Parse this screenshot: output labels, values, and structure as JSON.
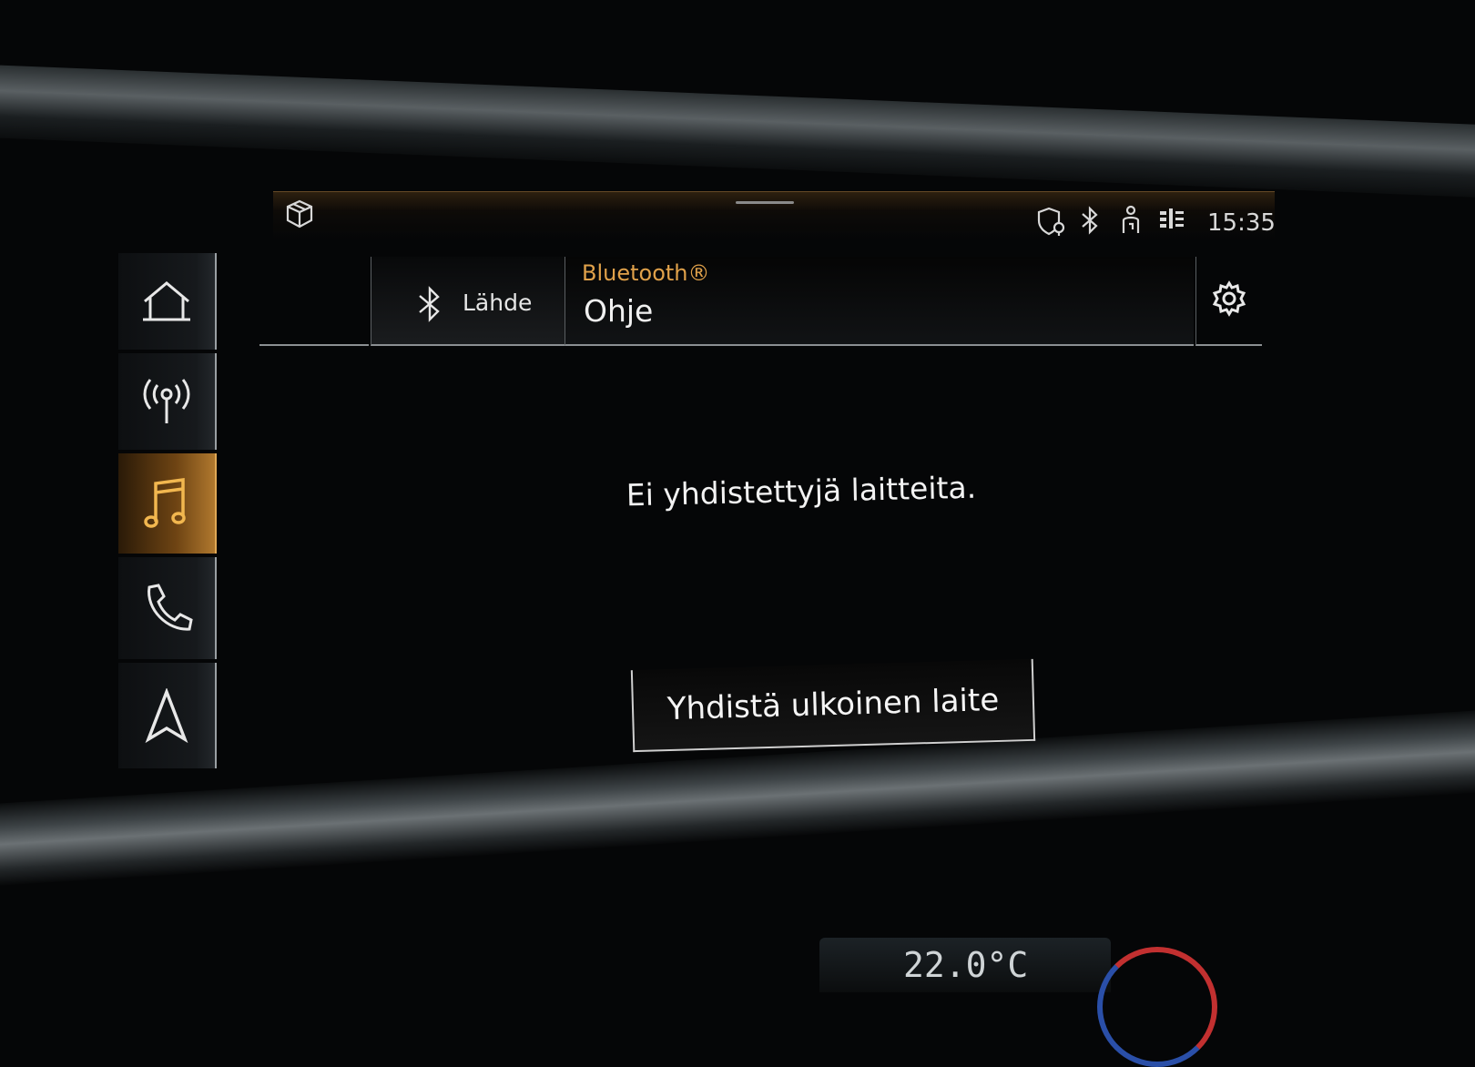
{
  "status_bar": {
    "time": "15:35",
    "icons": [
      "cube-icon",
      "location-shield-icon",
      "bluetooth-icon",
      "person-wifi-icon",
      "data-icon"
    ]
  },
  "sidebar": {
    "items": [
      {
        "icon": "home-icon",
        "active": false
      },
      {
        "icon": "radio-icon",
        "active": false
      },
      {
        "icon": "music-icon",
        "active": true
      },
      {
        "icon": "phone-icon",
        "active": false
      },
      {
        "icon": "navigation-icon",
        "active": false
      }
    ]
  },
  "tabs": {
    "source_label": "Lähde",
    "supertitle": "Bluetooth®",
    "title": "Ohje"
  },
  "content": {
    "empty_message": "Ei yhdistettyjä laitteita.",
    "connect_button_label": "Yhdistä ulkoinen laite"
  },
  "climate": {
    "temperature": "22.0°C"
  },
  "colors": {
    "accent": "#e0a14a",
    "background": "#050607",
    "text": "#f0f0f0"
  }
}
